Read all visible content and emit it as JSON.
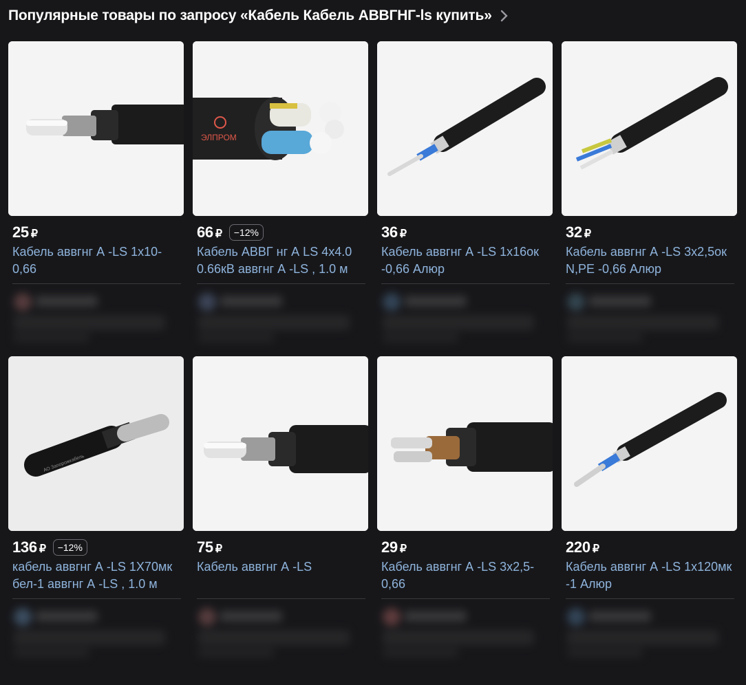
{
  "header": {
    "title": "Популярные товары по запросу «Кабель Кабель АВВГНГ-ls купить»"
  },
  "currency": "₽",
  "products": [
    {
      "price": "25",
      "discount": "",
      "title": "Кабель аввгнг А -LS 1х10-0,66",
      "image": "cable-single-core-silver"
    },
    {
      "price": "66",
      "discount": "−12%",
      "title": "Кабель АВВГ нг А LS 4х4.0 0.66кВ аввгнг А -LS , 1.0 м",
      "image": "cable-multicore-elprom"
    },
    {
      "price": "36",
      "discount": "",
      "title": "Кабель аввгнг А -LS 1х16ок -0,66 Алюр",
      "image": "cable-single-core-blue"
    },
    {
      "price": "32",
      "discount": "",
      "title": "Кабель аввгнг А -LS 3х2,5ок N,PE -0,66 Алюр",
      "image": "cable-three-core"
    },
    {
      "price": "136",
      "discount": "−12%",
      "title": "кабель аввгнг А -LS 1Х70мк бел-1 аввгнг А -LS , 1.0 м",
      "image": "cable-stranded"
    },
    {
      "price": "75",
      "discount": "",
      "title": "Кабель аввгнг А -LS",
      "image": "cable-single-core-silver"
    },
    {
      "price": "29",
      "discount": "",
      "title": "Кабель аввгнг А -LS 3х2,5-0,66",
      "image": "cable-multicore-brown"
    },
    {
      "price": "220",
      "discount": "",
      "title": "Кабель аввгнг А -LS 1х120мк -1 Алюр",
      "image": "cable-single-core-blue"
    }
  ],
  "colors": {
    "background": "#17171a",
    "link": "#8fb4dc",
    "badge_border": "#6a6a70"
  }
}
